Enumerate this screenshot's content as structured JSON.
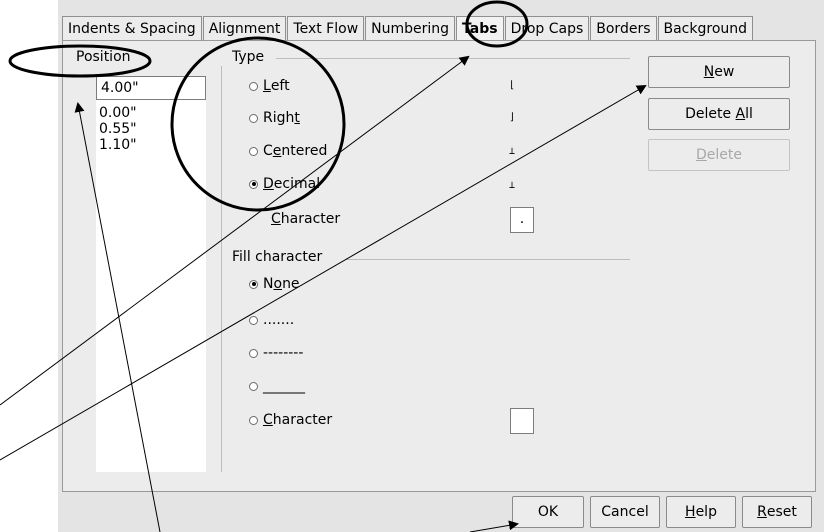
{
  "tabs": [
    "Indents & Spacing",
    "Alignment",
    "Text Flow",
    "Numbering",
    "Tabs",
    "Drop Caps",
    "Borders",
    "Background"
  ],
  "active_tab": "Tabs",
  "position": {
    "label": "Position",
    "value": "4.00\"",
    "items": [
      "0.00\"",
      "0.55\"",
      "1.10\""
    ]
  },
  "type": {
    "label": "Type",
    "options": [
      {
        "pre": "",
        "u": "L",
        "post": "eft",
        "checked": false
      },
      {
        "pre": "Righ",
        "u": "t",
        "post": "",
        "checked": false
      },
      {
        "pre": "C",
        "u": "e",
        "post": "ntered",
        "checked": false
      },
      {
        "pre": "",
        "u": "D",
        "post": "ecimal",
        "checked": true
      }
    ],
    "character_label_u": "C",
    "character_label_rest": "haracter",
    "character_value": "."
  },
  "fill": {
    "label": "Fill character",
    "none_pre": "N",
    "none_u": "o",
    "none_post": "ne",
    "dots": ".......",
    "dashes": "--------",
    "underscores": "______",
    "character_u": "C",
    "character_rest": "haracter",
    "character_value": ""
  },
  "buttons": {
    "new_u": "N",
    "new_rest": "ew",
    "delete_all_pre": "Delete ",
    "delete_all_u": "A",
    "delete_all_rest": "ll",
    "delete_u": "D",
    "delete_rest": "elete",
    "ok": "OK",
    "cancel": "Cancel",
    "help_u": "H",
    "help_rest": "elp",
    "reset_u": "R",
    "reset_rest": "eset"
  }
}
